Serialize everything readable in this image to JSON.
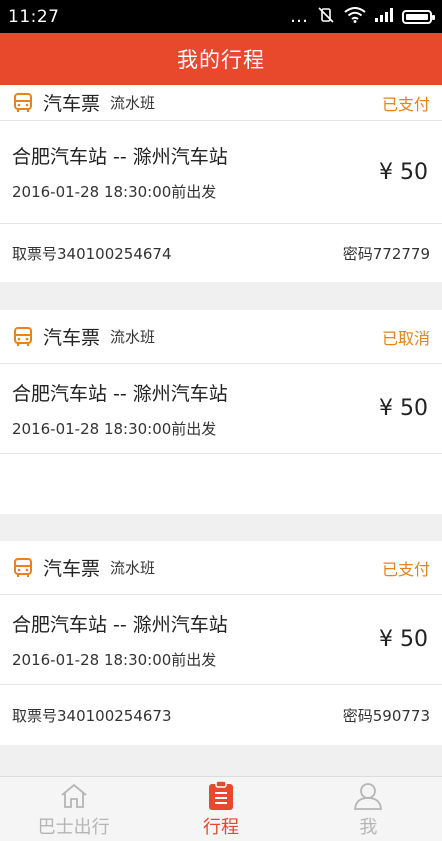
{
  "statusbar": {
    "time": "11:27"
  },
  "header": {
    "title": "我的行程"
  },
  "colors": {
    "brand": "#e8492d",
    "status": "#e8821a"
  },
  "trips": [
    {
      "type": "汽车票",
      "sub": "流水班",
      "status": "已支付",
      "route": "合肥汽车站 -- 滁州汽车站",
      "depart": "2016-01-28 18:30:00前出发",
      "price": "¥ 50",
      "ticket_no": "取票号340100254674",
      "password": "密码772779"
    },
    {
      "type": "汽车票",
      "sub": "流水班",
      "status": "已取消",
      "route": "合肥汽车站 -- 滁州汽车站",
      "depart": "2016-01-28 18:30:00前出发",
      "price": "¥ 50",
      "ticket_no": "",
      "password": ""
    },
    {
      "type": "汽车票",
      "sub": "流水班",
      "status": "已支付",
      "route": "合肥汽车站 -- 滁州汽车站",
      "depart": "2016-01-28 18:30:00前出发",
      "price": "¥ 50",
      "ticket_no": "取票号340100254673",
      "password": "密码590773"
    }
  ],
  "tabs": [
    {
      "label": "巴士出行",
      "icon": "home-icon"
    },
    {
      "label": "行程",
      "icon": "clipboard-icon"
    },
    {
      "label": "我",
      "icon": "person-icon"
    }
  ]
}
